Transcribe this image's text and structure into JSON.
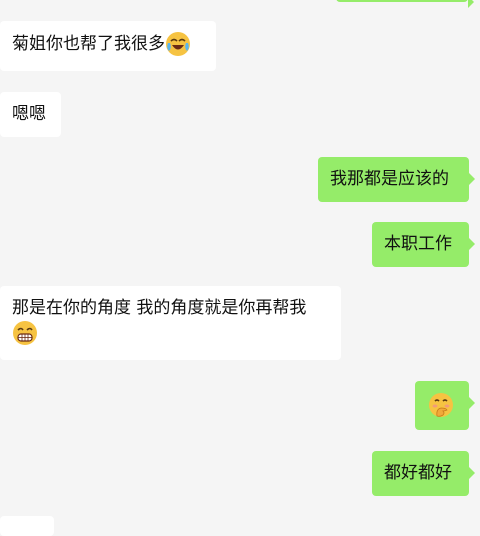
{
  "messages": [
    {
      "side": "out",
      "text": ""
    },
    {
      "side": "in",
      "text": "菊姐你也帮了我很多",
      "emoji": "laughing-crying-emoji"
    },
    {
      "side": "in",
      "text": "嗯嗯"
    },
    {
      "side": "out",
      "text": "我那都是应该的"
    },
    {
      "side": "out",
      "text": "本职工作"
    },
    {
      "side": "in",
      "text": "那是在你的角度  我的角度就是你再帮我",
      "emoji": "grinning-emoji"
    },
    {
      "side": "out",
      "text": "",
      "emoji": "blushing-hand-over-mouth-emoji"
    },
    {
      "side": "out",
      "text": "都好都好"
    },
    {
      "side": "in",
      "text": ""
    }
  ],
  "colors": {
    "background": "#f5f5f5",
    "incoming": "#ffffff",
    "outgoing": "#95ec69"
  }
}
